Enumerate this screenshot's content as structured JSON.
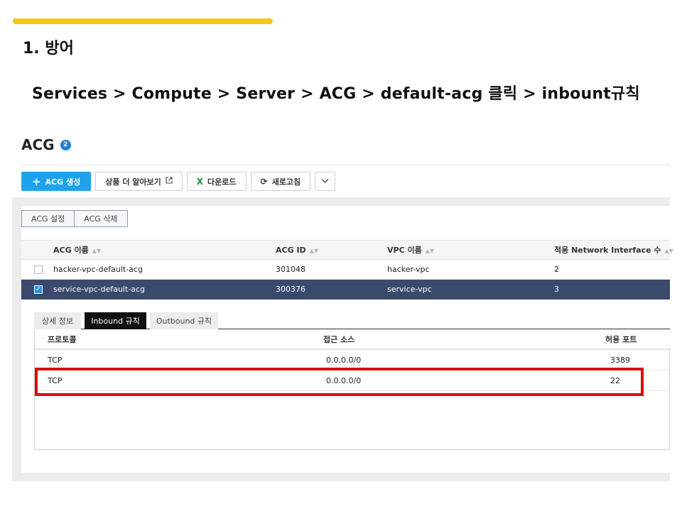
{
  "slide": {
    "section_title": "1. 방어",
    "path": "Services > Compute > Server > ACG > default-acg  클릭 > inbount규칙"
  },
  "colors": {
    "accent_bar": "#f5c518",
    "primary_button": "#1fa2ea",
    "selected_row": "#3b4a6b",
    "highlight": "#d90d0d",
    "count_badge": "#1f7ed8"
  },
  "acg": {
    "title": "ACG",
    "count": "2",
    "toolbar": {
      "create_icon": "plus-icon",
      "create_label": "ACG 생성",
      "learn_more_label": "상품 더 알아보기",
      "learn_more_icon": "external-link-icon",
      "download_icon": "excel-icon",
      "download_label": "다운로드",
      "refresh_icon": "refresh-icon",
      "refresh_label": "새로고침",
      "more_icon": "chevron-down-icon"
    },
    "actions": {
      "settings_label": "ACG 설정",
      "delete_label": "ACG 삭제"
    },
    "table": {
      "columns": {
        "name": "ACG 이름",
        "id": "ACG ID",
        "vpc": "VPC 이름",
        "nic": "적용 Network Interface 수"
      },
      "rows": [
        {
          "name": "hacker-vpc-default-acg",
          "id": "301048",
          "vpc": "hacker-vpc",
          "nic": "2",
          "checked": false
        },
        {
          "name": "service-vpc-default-acg",
          "id": "300376",
          "vpc": "service-vpc",
          "nic": "3",
          "checked": true
        }
      ]
    },
    "detail": {
      "tabs": [
        "상세 정보",
        "Inbound 규칙",
        "Outbound 규칙"
      ],
      "active_tab": "Inbound 규칙",
      "rules": {
        "columns": {
          "protocol": "프로토콜",
          "source": "접근 소스",
          "port": "허용 포트"
        },
        "rows": [
          {
            "protocol": "TCP",
            "source": "0.0.0.0/0",
            "port": "3389"
          },
          {
            "protocol": "TCP",
            "source": "0.0.0.0/0",
            "port": "22"
          }
        ]
      }
    }
  }
}
